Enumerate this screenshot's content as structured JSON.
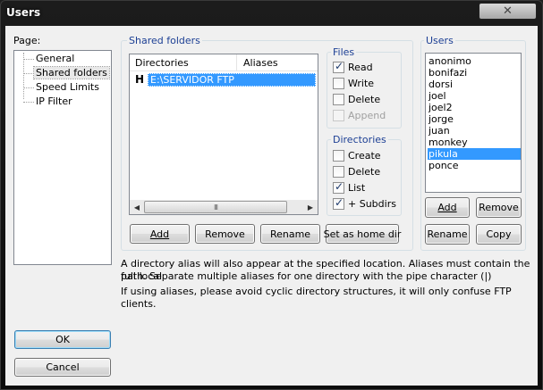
{
  "window": {
    "title": "Users",
    "close_glyph": "✕"
  },
  "page_nav": {
    "label": "Page:",
    "items": [
      "General",
      "Shared folders",
      "Speed Limits",
      "IP Filter"
    ],
    "selected": "Shared folders"
  },
  "shared_folders": {
    "group_title": "Shared folders",
    "columns": [
      "Directories",
      "Aliases"
    ],
    "rows": [
      {
        "marker": "H",
        "directory": "E:\\SERVIDOR FTP",
        "alias": ""
      }
    ],
    "scroll_thumb_glyph": "III",
    "buttons": {
      "add": "Add",
      "remove": "Remove",
      "rename": "Rename",
      "set_home": "Set as home dir"
    }
  },
  "files": {
    "title": "Files",
    "read": "Read",
    "write": "Write",
    "delete": "Delete",
    "append": "Append"
  },
  "directories": {
    "title": "Directories",
    "create": "Create",
    "delete": "Delete",
    "list": "List",
    "subdirs": "+ Subdirs"
  },
  "users": {
    "title": "Users",
    "list": [
      "anonimo",
      "bonifazi",
      "dorsi",
      "joel",
      "joel2",
      "jorge",
      "juan",
      "monkey",
      "pikula",
      "ponce"
    ],
    "selected": "pikula",
    "buttons": {
      "add": "Add",
      "remove": "Remove",
      "rename": "Rename",
      "copy": "Copy"
    }
  },
  "description": {
    "line1": "A directory alias will also appear at the specified location. Aliases must contain the full local",
    "line2": "path. Separate multiple aliases for one directory with the pipe character (|)",
    "line3": "If using aliases, please avoid cyclic directory structures, it will only confuse FTP clients."
  },
  "dialog_buttons": {
    "ok": "OK",
    "cancel": "Cancel"
  },
  "checkbox_state": {
    "read": true,
    "write": false,
    "delete": false,
    "append": false,
    "create": false,
    "dir_delete": false,
    "list": true,
    "subdirs": true
  },
  "colors": {
    "selection": "#3399ff",
    "group_title": "#1c3f94"
  }
}
